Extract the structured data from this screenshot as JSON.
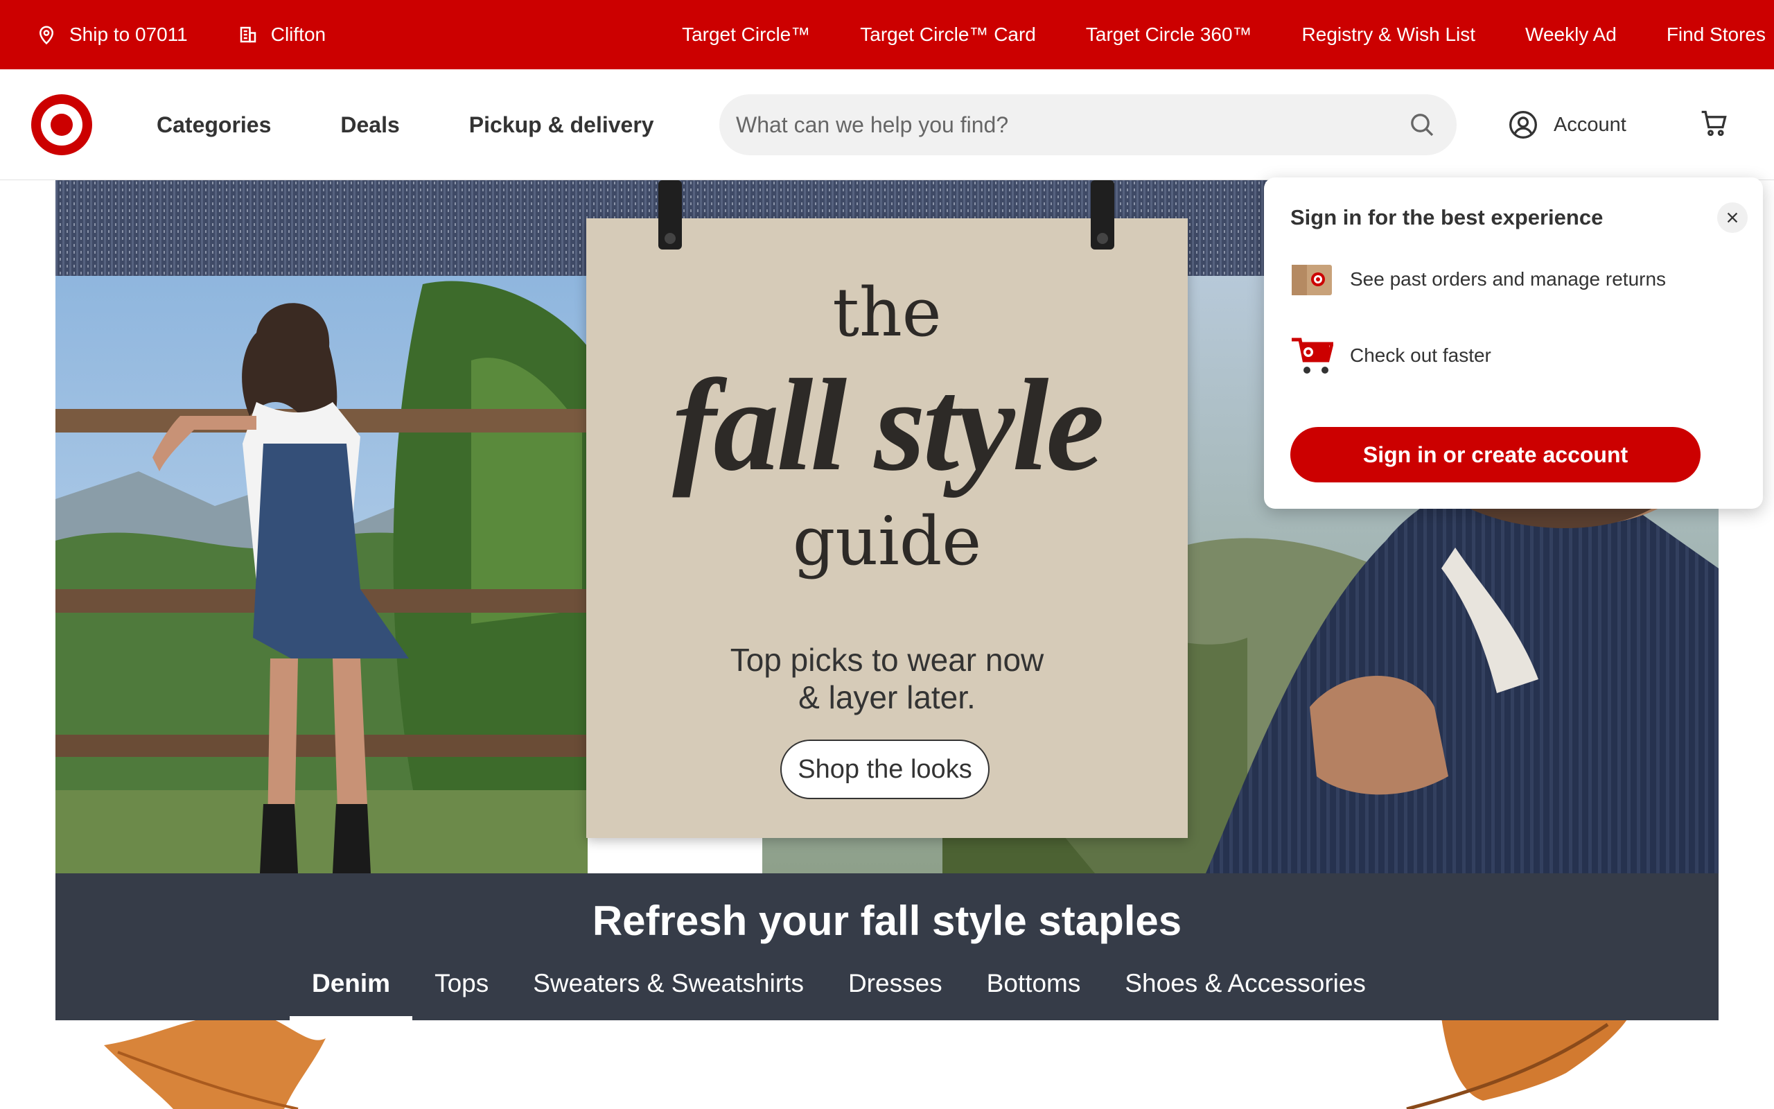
{
  "utility_bar": {
    "ship_to": "Ship to 07011",
    "store": "Clifton",
    "links": [
      "Target Circle™",
      "Target Circle™ Card",
      "Target Circle 360™",
      "Registry & Wish List",
      "Weekly Ad",
      "Find Stores"
    ]
  },
  "header": {
    "nav": [
      "Categories",
      "Deals",
      "Pickup & delivery"
    ],
    "search_placeholder": "What can we help you find?",
    "account_label": "Account"
  },
  "hero": {
    "title_top": "the",
    "title_main": "fall style",
    "title_bottom": "guide",
    "subtitle_line1": "Top picks to wear now",
    "subtitle_line2": "& layer later.",
    "cta": "Shop the looks"
  },
  "band": {
    "title": "Refresh your fall style staples",
    "tabs": [
      "Denim",
      "Tops",
      "Sweaters & Sweatshirts",
      "Dresses",
      "Bottoms",
      "Shoes & Accessories"
    ],
    "active_tab": "Denim"
  },
  "popover": {
    "title": "Sign in for the best experience",
    "items": [
      "See past orders and manage returns",
      "Check out faster"
    ],
    "button": "Sign in or create account"
  },
  "colors": {
    "brand_red": "#cc0000",
    "band_bg": "#363c48",
    "card_bg": "#d6cbb8"
  }
}
